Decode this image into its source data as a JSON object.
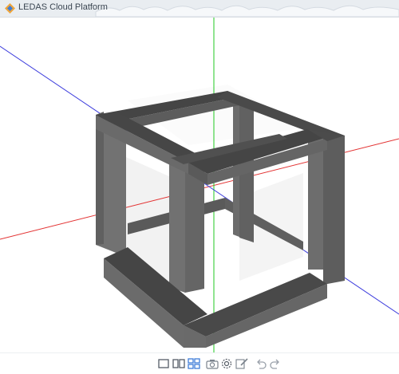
{
  "app": {
    "title": "LEDAS Cloud Platform"
  },
  "icons": [
    "logo-icon"
  ],
  "toolbar": {
    "buttons": [
      {
        "name": "single-view-button",
        "icon": "single-view-icon",
        "active": false
      },
      {
        "name": "two-views-button",
        "icon": "two-views-icon",
        "active": false
      },
      {
        "name": "four-views-button",
        "icon": "four-views-icon",
        "active": true
      },
      {
        "name": "screenshot-button",
        "icon": "camera-icon",
        "active": false
      },
      {
        "name": "settings-button",
        "icon": "gear-icon",
        "active": false
      },
      {
        "name": "edit-button",
        "icon": "pencil-icon",
        "active": false
      },
      {
        "name": "undo-button",
        "icon": "undo-icon",
        "active": false
      },
      {
        "name": "redo-button",
        "icon": "redo-icon",
        "active": false
      }
    ]
  },
  "colors": {
    "x_axis": "#e33333",
    "y_axis": "#22c922",
    "z_axis": "#3c3cdd",
    "model_light": "#707070",
    "model_dark": "#4b4b4b",
    "model_shadow": "#5e5e5e",
    "accent": "#3e7dd8"
  }
}
